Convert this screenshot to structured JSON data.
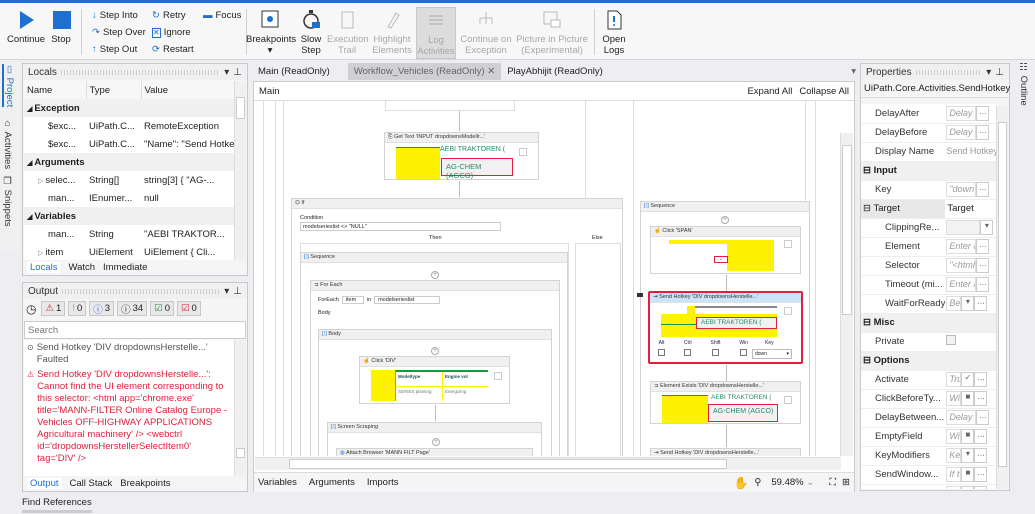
{
  "ribbon": {
    "continue": "Continue",
    "stop": "Stop",
    "step_into": "Step Into",
    "step_over": "Step Over",
    "step_out": "Step Out",
    "retry": "Retry",
    "ignore": "Ignore",
    "restart": "Restart",
    "focus": "Focus",
    "breakpoints": "Breakpoints",
    "slow_step": "Slow Step",
    "execution_trail": "Execution Trail",
    "highlight_elements": "Highlight Elements",
    "log_activities": "Log Activities",
    "continue_on_exception": "Continue on Exception",
    "picture_in_picture": "Picture in Picture (Experimental)",
    "open_logs": "Open Logs"
  },
  "left_strip": {
    "project": "Project",
    "activities": "Activities",
    "snippets": "Snippets"
  },
  "locals": {
    "title": "Locals",
    "columns": [
      "Name",
      "Type",
      "Value"
    ],
    "groups": [
      {
        "name": "Exception",
        "rows": [
          {
            "name": "$exc...",
            "type": "UiPath.C...",
            "value": "RemoteException"
          },
          {
            "name": "$exc...",
            "type": "UiPath.C...",
            "value": "\"Name\": \"Send Hotkey"
          }
        ]
      },
      {
        "name": "Arguments",
        "rows": [
          {
            "name": "selec...",
            "type": "String[]",
            "value": "string[3] { \"AG-..."
          },
          {
            "name": "man...",
            "type": "IEnumer...",
            "value": "null"
          }
        ]
      },
      {
        "name": "Variables",
        "rows": [
          {
            "name": "man...",
            "type": "String",
            "value": "\"AEBI TRAKTOR..."
          },
          {
            "name": "item",
            "type": "UiElement",
            "value": "UiElement { Cli..."
          }
        ]
      }
    ],
    "tabs": [
      "Locals",
      "Watch",
      "Immediate"
    ]
  },
  "output": {
    "title": "Output",
    "filters": [
      "1",
      "0",
      "3",
      "34",
      "0",
      "0"
    ],
    "search_placeholder": "Search",
    "entries": [
      {
        "text": "Send Hotkey 'DIV  dropdownsHerstelle...' Faulted"
      },
      {
        "text": "Send Hotkey 'DIV  dropdownsHerstelle...': Cannot find the UI element corresponding to this selector: <html app='chrome.exe' title='MANN-FILTER Online Catalog Europe - Vehicles OFF-HIGHWAY APPLICATIONS Agricultural machinery' /> <webctrl id='dropdownsHerstellerSelectItem0' tag='DIV' />"
      }
    ],
    "tabs": [
      "Output",
      "Call Stack",
      "Breakpoints"
    ]
  },
  "find_references": "Find References",
  "designer": {
    "tabs": [
      "Main (ReadOnly)",
      "Workflow_Vehicles (ReadOnly)",
      "PlayAbhijit (ReadOnly)"
    ],
    "breadcrumb": "Main",
    "expand_all": "Expand All",
    "collapse_all": "Collapse All",
    "get_text": {
      "title": "Get Text 'INPUT  dropdownsModellr...'",
      "line1": "AEBI TRAKTOREN (",
      "line2": "AG-CHEM (AGCO)"
    },
    "if": {
      "title": "If",
      "condition_label": "Condition",
      "condition": "modelserieslist <> \"NULL\"",
      "then": "Then",
      "else": "Else"
    },
    "sequence": "Sequence",
    "for_each": {
      "title": "For Each",
      "label": "ForEach",
      "item": "item",
      "in": "in",
      "list": "modelserieslist",
      "body": "Body"
    },
    "body": "Body",
    "click_div": {
      "title": "Click 'DIV'",
      "col1": "Modeltype",
      "col2": "Engine vol",
      "val1": "SERIES planting",
      "val2": "Energizing"
    },
    "screen_scraping": "Screen Scraping",
    "attach_browser": "Attach Browser 'MANN FILT Page'",
    "right_sequence": "Sequence",
    "click_span": "Click 'SPAN'",
    "send_hotkey": {
      "title": "Send Hotkey 'DIV  dropdownsHerstelle...'",
      "preview": "AEBI TRAKTOREN (",
      "mods": [
        "Alt",
        "Ctrl",
        "Shift",
        "Win"
      ],
      "key_label": "Key",
      "key": "down"
    },
    "element_exists": {
      "title": "Element Exists 'DIV  dropdownsHerstelle...'",
      "line1": "AEBI TRAKTOREN (",
      "line2": "AG-CHEM (AGCO)"
    },
    "send_hotkey2": "Send Hotkey 'DIV  dropdownsHerstelle...'",
    "bottom_tabs": [
      "Variables",
      "Arguments",
      "Imports"
    ],
    "zoom": "59.48%"
  },
  "properties": {
    "title": "Properties",
    "class": "UiPath.Core.Activities.SendHotkey",
    "rows": [
      {
        "type": "prop",
        "name": "DelayAfter",
        "value": "Delay"
      },
      {
        "type": "prop",
        "name": "DelayBefore",
        "value": "Delay"
      },
      {
        "type": "prop",
        "name": "Display Name",
        "value": "Send Hotkey"
      },
      {
        "type": "sec",
        "name": "Input"
      },
      {
        "type": "prop",
        "name": "Key",
        "value": "\"down\""
      },
      {
        "type": "sec2",
        "name": "Target",
        "value": "Target"
      },
      {
        "type": "sub",
        "name": "ClippingRe...",
        "value": ""
      },
      {
        "type": "sub",
        "name": "Element",
        "value": "Enter a"
      },
      {
        "type": "sub",
        "name": "Selector",
        "value": "\"<html"
      },
      {
        "type": "sub",
        "name": "Timeout (mi...",
        "value": "Enter a"
      },
      {
        "type": "sub",
        "name": "WaitForReady",
        "value": "Be"
      },
      {
        "type": "sec",
        "name": "Misc"
      },
      {
        "type": "prop",
        "name": "Private",
        "value": ""
      },
      {
        "type": "sec",
        "name": "Options"
      },
      {
        "type": "prop",
        "name": "Activate",
        "value": "True"
      },
      {
        "type": "prop",
        "name": "ClickBeforeTy...",
        "value": "Wi"
      },
      {
        "type": "prop",
        "name": "DelayBetween...",
        "value": "Delay"
      },
      {
        "type": "prop",
        "name": "EmptyField",
        "value": "Wi"
      },
      {
        "type": "prop",
        "name": "KeyModifiers",
        "value": "Ke"
      },
      {
        "type": "prop",
        "name": "SendWindow...",
        "value": "If t"
      },
      {
        "type": "prop",
        "name": "SpecialKey",
        "value": "True"
      }
    ]
  },
  "right_strip": {
    "outline": "Outline"
  },
  "colors": {
    "accent": "#1e6fd0",
    "error": "#e0203c",
    "highlight": "#fff200"
  }
}
